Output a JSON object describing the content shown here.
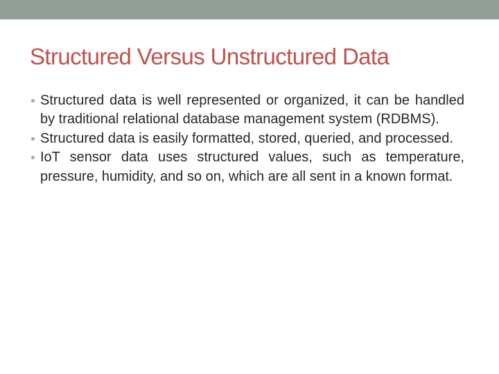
{
  "slide": {
    "title": "Structured Versus Unstructured Data",
    "colors": {
      "top_bar": "#939F97",
      "title": "#C0504D",
      "body_text": "#262626",
      "bullet": "#A5A5A5"
    },
    "bullets": [
      {
        "icon": "bullet-dot-icon",
        "text": "Structured data is well represented or organized, it can be handled by traditional relational database management system (RDBMS)."
      },
      {
        "icon": "bullet-dot-icon",
        "text": "Structured data is easily formatted, stored, queried, and processed."
      },
      {
        "icon": "bullet-dot-icon",
        "text": "IoT sensor data uses structured values, such as temperature, pressure, humidity, and so on, which are all sent in a known format."
      }
    ]
  }
}
